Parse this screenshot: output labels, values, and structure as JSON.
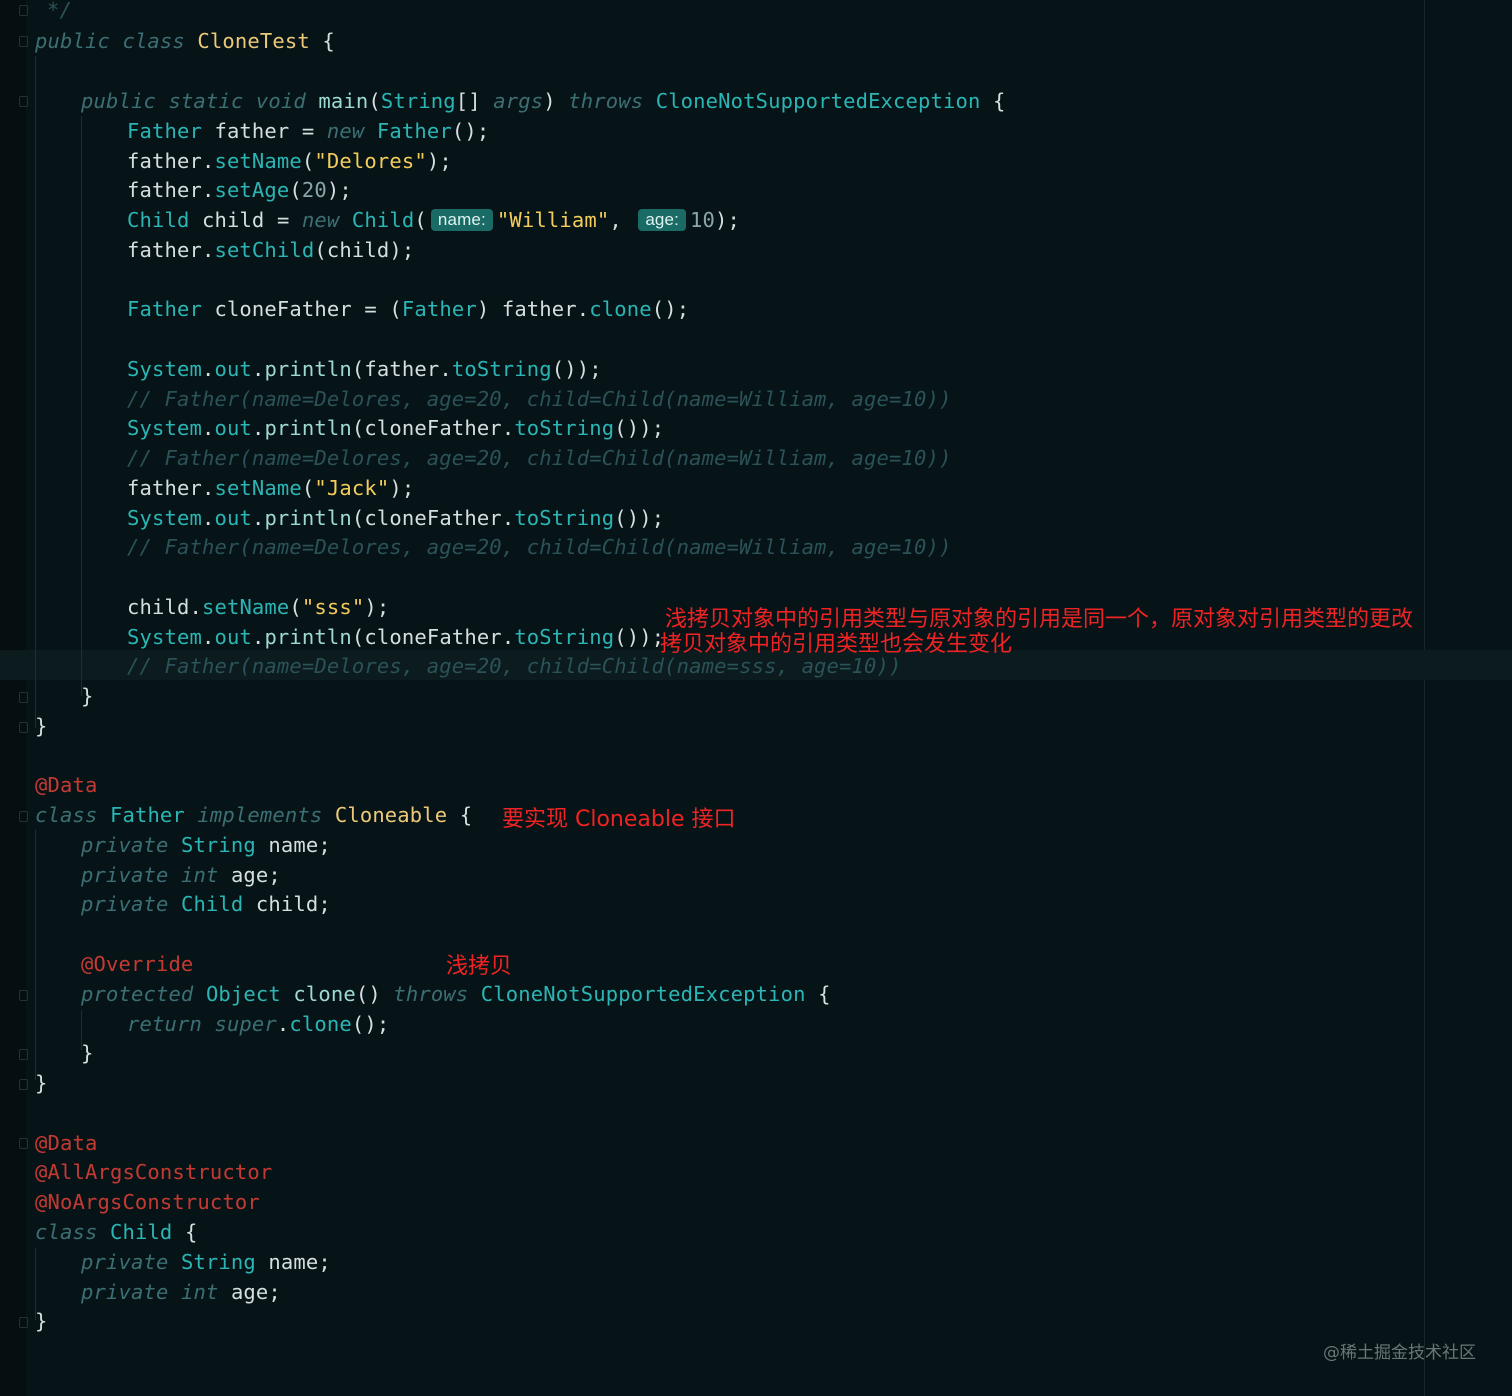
{
  "colors": {
    "background": "#071417",
    "keyword": "#3c6f74",
    "type": "#2bb5b4",
    "string": "#f3cc5b",
    "comment": "#2a5257",
    "annotation": "#c43a33",
    "note": "#ef2323"
  },
  "code": {
    "l00": "*/",
    "l01": {
      "k1": "public",
      "k2": "class",
      "name": "CloneTest",
      "brace": "{"
    },
    "l03": {
      "k1": "public",
      "k2": "static",
      "k3": "void",
      "m": "main",
      "p1": "(",
      "t": "String",
      "arr": "[]",
      "arg": "args",
      "p2": ")",
      "k4": "throws",
      "ex": "CloneNotSupportedException",
      "brace": "{"
    },
    "l04": {
      "t": "Father",
      "v": "father",
      "eq": "=",
      "k": "new",
      "c": "Father",
      "end": "();"
    },
    "l05": {
      "v": "father",
      "dot": ".",
      "m": "setName",
      "p": "(",
      "s": "\"Delores\"",
      "end": ");"
    },
    "l06": {
      "v": "father",
      "dot": ".",
      "m": "setAge",
      "p": "(",
      "n": "20",
      "end": ");"
    },
    "l07": {
      "t": "Child",
      "v": "child",
      "eq": "=",
      "k": "new",
      "c": "Child",
      "p": "(",
      "h1": "name:",
      "s": "\"William\"",
      "comma": ",",
      "h2": "age:",
      "n": "10",
      "end": ");"
    },
    "l08": {
      "v": "father",
      "dot": ".",
      "m": "setChild",
      "arg": "(child);"
    },
    "l10": {
      "t": "Father",
      "v": "cloneFather",
      "eq": "=",
      "cast_open": "(",
      "cast": "Father",
      "cast_close": ")",
      "obj": "father",
      "dot": ".",
      "m": "clone",
      "end": "();"
    },
    "l12": {
      "sys": "System",
      "d1": ".",
      "out": "out",
      "d2": ".",
      "pr": "println",
      "p": "(",
      "obj": "father",
      "d3": ".",
      "ts": "toString",
      "end": "());"
    },
    "l13": "// Father(name=Delores, age=20, child=Child(name=William, age=10))",
    "l14": {
      "sys": "System",
      "d1": ".",
      "out": "out",
      "d2": ".",
      "pr": "println",
      "p": "(",
      "obj": "cloneFather",
      "d3": ".",
      "ts": "toString",
      "end": "());"
    },
    "l15": "// Father(name=Delores, age=20, child=Child(name=William, age=10))",
    "l16": {
      "v": "father",
      "dot": ".",
      "m": "setName",
      "p": "(",
      "s": "\"Jack\"",
      "end": ");"
    },
    "l17": {
      "sys": "System",
      "d1": ".",
      "out": "out",
      "d2": ".",
      "pr": "println",
      "p": "(",
      "obj": "cloneFather",
      "d3": ".",
      "ts": "toString",
      "end": "());"
    },
    "l18": "// Father(name=Delores, age=20, child=Child(name=William, age=10))",
    "l20": {
      "v": "child",
      "dot": ".",
      "m": "setName",
      "p": "(",
      "s": "\"sss\"",
      "end": ");"
    },
    "l21": {
      "sys": "System",
      "d1": ".",
      "out": "out",
      "d2": ".",
      "pr": "println",
      "p": "(",
      "obj": "cloneFather",
      "d3": ".",
      "ts": "toString",
      "end": "());"
    },
    "l22": "// Father(name=Delores, age=20, child=Child(name=sss, age=10))",
    "l23": "}",
    "l24": "}",
    "l26": "@Data",
    "l27": {
      "k1": "class",
      "name": "Father",
      "k2": "implements",
      "iface": "Cloneable",
      "brace": "{"
    },
    "l28": {
      "k": "private",
      "t": "String",
      "v": "name;"
    },
    "l29": {
      "k": "private",
      "t": "int",
      "v": "age;"
    },
    "l30": {
      "k": "private",
      "t": "Child",
      "v": "child;"
    },
    "l32": "@Override",
    "l33": {
      "k1": "protected",
      "t": "Object",
      "m": "clone",
      "p": "()",
      "k2": "throws",
      "ex": "CloneNotSupportedException",
      "brace": "{"
    },
    "l34": {
      "k1": "return",
      "k2": "super",
      "dot": ".",
      "m": "clone",
      "end": "();"
    },
    "l35": "}",
    "l36": "}",
    "l38": "@Data",
    "l39": "@AllArgsConstructor",
    "l40": "@NoArgsConstructor",
    "l41": {
      "k1": "class",
      "name": "Child",
      "brace": "{"
    },
    "l42": {
      "k": "private",
      "t": "String",
      "v": "name;"
    },
    "l43": {
      "k": "private",
      "t": "int",
      "v": "age;"
    },
    "l44": "}"
  },
  "notes": {
    "shallow_line1": "浅拷贝对象中的引用类型与原对象的引用是同一个，原对象对引用类型的更改",
    "shallow_line2": "拷贝对象中的引用类型也会发生变化",
    "cloneable": "要实现 Cloneable 接口",
    "shallow": "浅拷贝"
  },
  "watermark": "@稀土掘金技术社区"
}
